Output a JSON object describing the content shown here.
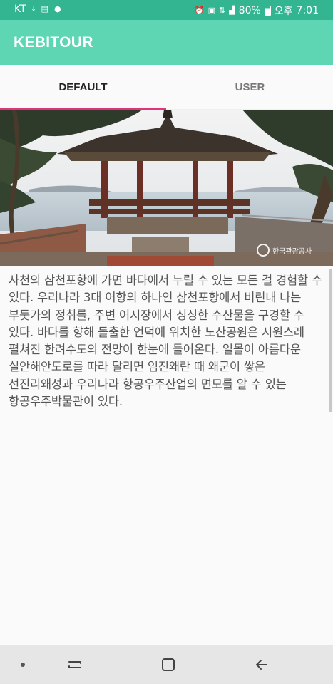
{
  "status_bar": {
    "carrier": "KT",
    "battery": "80%",
    "ampm": "오후",
    "time": "7:01",
    "left_icons": [
      "download-icon",
      "storage-icon",
      "talk-icon"
    ],
    "right_icons": [
      "alarm-icon",
      "hd-icon",
      "lte-icon",
      "signal-icon",
      "battery-icon"
    ]
  },
  "app": {
    "title": "KEBITOUR",
    "colors": {
      "status": "#33b592",
      "appbar": "#5ed6b4",
      "tab_indicator": "#e0357b"
    }
  },
  "tabs": [
    {
      "label": "DEFAULT",
      "selected": true
    },
    {
      "label": "USER",
      "selected": false
    }
  ],
  "hero": {
    "description_icon": "pavilion-photo",
    "watermark_text": "한국관광공사"
  },
  "content": {
    "text": "사천의 삼천포항에 가면 바다에서 누릴 수 있는 모든 걸 경험할 수 있다. 우리나라 3대 어항의 하나인 삼천포항에서 비린내 나는 부둣가의 정취를, 주변 어시장에서 싱싱한 수산물을 구경할 수 있다. 바다를 향해 돌출한 언덕에 위치한 노산공원은 시원스레 펼쳐진 한려수도의 전망이 한눈에 들어온다. 일몰이 아름다운 실안해안도로를 따라 달리면 임진왜란 때 왜군이 쌓은 선진리왜성과 우리나라 항공우주산업의 면모를 알 수 있는 항공우주박물관이 있다."
  },
  "nav_bar": {
    "buttons": [
      "dot-icon",
      "recent-apps-icon",
      "home-icon",
      "back-icon"
    ]
  }
}
